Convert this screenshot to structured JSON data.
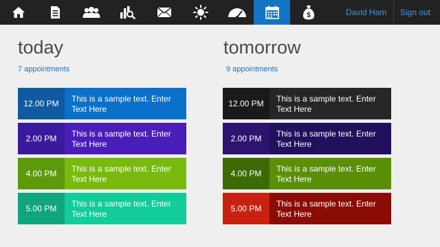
{
  "nav": {
    "icons": [
      {
        "name": "home-icon"
      },
      {
        "name": "document-icon"
      },
      {
        "name": "users-icon"
      },
      {
        "name": "chart-search-icon"
      },
      {
        "name": "mail-icon"
      },
      {
        "name": "sun-icon"
      },
      {
        "name": "dashboard-gauge-icon"
      },
      {
        "name": "calendar-icon",
        "active": true
      },
      {
        "name": "money-bag-icon"
      }
    ],
    "user_name": "David Ham",
    "signout_label": "Sign out"
  },
  "colors": {
    "topbar": "#222222",
    "active_tab": "#1373c5",
    "link": "#3e95e0",
    "background": "#efefef"
  },
  "today": {
    "title": "today",
    "count_label": "7 appointments",
    "items": [
      {
        "time": "12.00 PM",
        "text": "This is a sample text. Enter Text Here",
        "time_color": "#0f5aa0",
        "color": "#0a70c9"
      },
      {
        "time": "2.00 PM",
        "text": "This is a sample text. Enter Text Here",
        "time_color": "#3a1a9c",
        "color": "#4b1db8"
      },
      {
        "time": "4.00 PM",
        "text": "This is a sample text. Enter Text Here",
        "time_color": "#5c9a0c",
        "color": "#78bb0e"
      },
      {
        "time": "5.00 PM",
        "text": "This is a sample text. Enter Text Here",
        "time_color": "#10a57d",
        "color": "#12cc9a"
      }
    ]
  },
  "tomorrow": {
    "title": "tomorrow",
    "count_label": "9 appointments",
    "items": [
      {
        "time": "12.00 PM",
        "text": "This is a sample text. Enter Text Here",
        "time_color": "#1a1a1a",
        "color": "#262626"
      },
      {
        "time": "2.00 PM",
        "text": "This is a sample text. Enter Text Here",
        "time_color": "#2c1470",
        "color": "#22105c"
      },
      {
        "time": "4.00 PM",
        "text": "This is a sample text. Enter Text Here",
        "time_color": "#3e6a06",
        "color": "#5a8f08"
      },
      {
        "time": "5.00 PM",
        "text": "This is a sample text. Enter Text Here",
        "time_color": "#c9210f",
        "color": "#8a0c04"
      }
    ]
  }
}
